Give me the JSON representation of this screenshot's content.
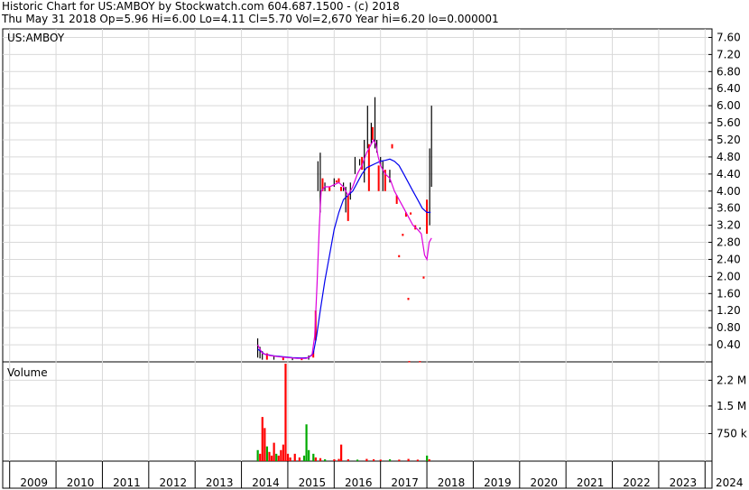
{
  "header": {
    "title": "Historic Chart for US:AMBOY by Stockwatch.com 604.687.1500 - (c) 2018",
    "info": "Thu May 31 2018  Op=5.96  Hi=6.00  Lo=4.11  Cl=5.70  Vol=2,670  Year hi=6.20  lo=0.000001"
  },
  "colors": {
    "up": "#000000",
    "down": "#ff0000",
    "ma_short": "#dd00dd",
    "ma_long": "#0000ee",
    "grid": "#d9d9d9",
    "vol_red": "#ff0000",
    "vol_green": "#00aa00"
  },
  "chart_data": [
    {
      "type": "line",
      "title": "US:AMBOY",
      "ylim": [
        0,
        7.8
      ],
      "y_ticks": [
        "7.60",
        "7.20",
        "6.80",
        "6.40",
        "6.00",
        "5.60",
        "5.20",
        "4.80",
        "4.40",
        "4.00",
        "3.60",
        "3.20",
        "2.80",
        "2.40",
        "2.00",
        "1.60",
        "1.20",
        "0.80",
        "0.40"
      ],
      "x_ticks": [
        "2009",
        "2010",
        "2011",
        "2012",
        "2013",
        "2014",
        "2015",
        "2016",
        "2017",
        "2018",
        "2019",
        "2020",
        "2021",
        "2022",
        "2023",
        "2024"
      ],
      "price_bars": [
        {
          "x": 2014.35,
          "hi": 0.55,
          "lo": 0.1,
          "c": "up"
        },
        {
          "x": 2014.4,
          "hi": 0.35,
          "lo": 0.08,
          "c": "up"
        },
        {
          "x": 2014.45,
          "hi": 0.25,
          "lo": 0.05,
          "c": "up"
        },
        {
          "x": 2014.55,
          "hi": 0.2,
          "lo": 0.05,
          "c": "down"
        },
        {
          "x": 2014.7,
          "hi": 0.15,
          "lo": 0.05,
          "c": "up"
        },
        {
          "x": 2014.9,
          "hi": 0.12,
          "lo": 0.04,
          "c": "down"
        },
        {
          "x": 2015.1,
          "hi": 0.1,
          "lo": 0.04,
          "c": "up"
        },
        {
          "x": 2015.3,
          "hi": 0.1,
          "lo": 0.04,
          "c": "down"
        },
        {
          "x": 2015.45,
          "hi": 0.15,
          "lo": 0.05,
          "c": "up"
        },
        {
          "x": 2015.55,
          "hi": 0.25,
          "lo": 0.1,
          "c": "down"
        },
        {
          "x": 2015.6,
          "hi": 1.2,
          "lo": 0.5,
          "c": "down"
        },
        {
          "x": 2015.65,
          "hi": 4.7,
          "lo": 4.0,
          "c": "up"
        },
        {
          "x": 2015.7,
          "hi": 4.9,
          "lo": 3.5,
          "c": "up"
        },
        {
          "x": 2015.75,
          "hi": 4.3,
          "lo": 4.0,
          "c": "down"
        },
        {
          "x": 2015.8,
          "hi": 4.2,
          "lo": 4.0,
          "c": "up"
        },
        {
          "x": 2015.9,
          "hi": 4.1,
          "lo": 4.0,
          "c": "down"
        },
        {
          "x": 2016.0,
          "hi": 4.3,
          "lo": 4.1,
          "c": "up"
        },
        {
          "x": 2016.05,
          "hi": 4.25,
          "lo": 4.2,
          "c": "down"
        },
        {
          "x": 2016.1,
          "hi": 4.3,
          "lo": 4.2,
          "c": "down"
        },
        {
          "x": 2016.15,
          "hi": 4.1,
          "lo": 4.0,
          "c": "down"
        },
        {
          "x": 2016.2,
          "hi": 4.2,
          "lo": 4.0,
          "c": "up"
        },
        {
          "x": 2016.25,
          "hi": 4.1,
          "lo": 3.5,
          "c": "up"
        },
        {
          "x": 2016.3,
          "hi": 3.9,
          "lo": 3.3,
          "c": "down"
        },
        {
          "x": 2016.35,
          "hi": 4.2,
          "lo": 3.8,
          "c": "up"
        },
        {
          "x": 2016.45,
          "hi": 4.8,
          "lo": 4.4,
          "c": "up"
        },
        {
          "x": 2016.55,
          "hi": 4.75,
          "lo": 4.6,
          "c": "up"
        },
        {
          "x": 2016.6,
          "hi": 4.8,
          "lo": 4.5,
          "c": "down"
        },
        {
          "x": 2016.65,
          "hi": 5.2,
          "lo": 4.2,
          "c": "up"
        },
        {
          "x": 2016.72,
          "hi": 6.0,
          "lo": 5.0,
          "c": "up"
        },
        {
          "x": 2016.75,
          "hi": 5.1,
          "lo": 4.0,
          "c": "down"
        },
        {
          "x": 2016.8,
          "hi": 5.6,
          "lo": 5.1,
          "c": "up"
        },
        {
          "x": 2016.83,
          "hi": 5.5,
          "lo": 5.2,
          "c": "down"
        },
        {
          "x": 2016.88,
          "hi": 6.2,
          "lo": 5.0,
          "c": "up"
        },
        {
          "x": 2016.92,
          "hi": 5.2,
          "lo": 4.9,
          "c": "up"
        },
        {
          "x": 2016.96,
          "hi": 4.6,
          "lo": 4.0,
          "c": "down"
        },
        {
          "x": 2017.0,
          "hi": 4.8,
          "lo": 4.6,
          "c": "up"
        },
        {
          "x": 2017.05,
          "hi": 4.7,
          "lo": 4.0,
          "c": "up"
        },
        {
          "x": 2017.1,
          "hi": 4.5,
          "lo": 4.0,
          "c": "down"
        },
        {
          "x": 2017.2,
          "hi": 4.5,
          "lo": 4.2,
          "c": "up"
        },
        {
          "x": 2017.25,
          "hi": 5.1,
          "lo": 5.0,
          "c": "down"
        },
        {
          "x": 2017.35,
          "hi": 3.9,
          "lo": 3.7,
          "c": "down"
        },
        {
          "x": 2017.4,
          "hi": 2.5,
          "lo": 2.45,
          "c": "down"
        },
        {
          "x": 2017.48,
          "hi": 3.0,
          "lo": 2.95,
          "c": "down"
        },
        {
          "x": 2017.55,
          "hi": 3.5,
          "lo": 3.4,
          "c": "down"
        },
        {
          "x": 2017.6,
          "hi": 1.5,
          "lo": 1.45,
          "c": "down"
        },
        {
          "x": 2017.65,
          "hi": 3.5,
          "lo": 3.45,
          "c": "down"
        },
        {
          "x": 2017.75,
          "hi": 3.2,
          "lo": 3.1,
          "c": "down"
        },
        {
          "x": 2017.85,
          "hi": 3.15,
          "lo": 3.1,
          "c": "up"
        },
        {
          "x": 2017.93,
          "hi": 2.0,
          "lo": 1.95,
          "c": "down"
        },
        {
          "x": 2018.0,
          "hi": 3.8,
          "lo": 3.0,
          "c": "down"
        },
        {
          "x": 2018.06,
          "hi": 5.0,
          "lo": 3.2,
          "c": "up"
        },
        {
          "x": 2018.1,
          "hi": 6.0,
          "lo": 4.1,
          "c": "up"
        },
        {
          "x": 2017.62,
          "hi": 0.02,
          "lo": 0.0,
          "c": "down"
        },
        {
          "x": 2017.85,
          "hi": 0.02,
          "lo": 0.0,
          "c": "down"
        }
      ],
      "ma_short": [
        [
          2014.35,
          0.4
        ],
        [
          2014.45,
          0.2
        ],
        [
          2014.6,
          0.15
        ],
        [
          2014.8,
          0.12
        ],
        [
          2015.0,
          0.1
        ],
        [
          2015.2,
          0.08
        ],
        [
          2015.4,
          0.08
        ],
        [
          2015.52,
          0.15
        ],
        [
          2015.58,
          0.6
        ],
        [
          2015.63,
          1.8
        ],
        [
          2015.68,
          3.2
        ],
        [
          2015.72,
          4.0
        ],
        [
          2015.8,
          4.1
        ],
        [
          2015.9,
          4.1
        ],
        [
          2016.0,
          4.15
        ],
        [
          2016.1,
          4.2
        ],
        [
          2016.2,
          4.1
        ],
        [
          2016.3,
          3.9
        ],
        [
          2016.4,
          4.1
        ],
        [
          2016.5,
          4.4
        ],
        [
          2016.6,
          4.6
        ],
        [
          2016.7,
          4.9
        ],
        [
          2016.8,
          5.1
        ],
        [
          2016.85,
          5.2
        ],
        [
          2016.9,
          5.1
        ],
        [
          2016.95,
          4.8
        ],
        [
          2017.0,
          4.6
        ],
        [
          2017.1,
          4.4
        ],
        [
          2017.2,
          4.3
        ],
        [
          2017.3,
          4.0
        ],
        [
          2017.4,
          3.8
        ],
        [
          2017.5,
          3.6
        ],
        [
          2017.6,
          3.4
        ],
        [
          2017.7,
          3.2
        ],
        [
          2017.8,
          3.1
        ],
        [
          2017.88,
          3.0
        ],
        [
          2017.95,
          2.5
        ],
        [
          2018.0,
          2.4
        ],
        [
          2018.05,
          2.8
        ],
        [
          2018.1,
          2.9
        ]
      ],
      "ma_long": [
        [
          2014.35,
          0.3
        ],
        [
          2014.5,
          0.18
        ],
        [
          2014.7,
          0.14
        ],
        [
          2014.9,
          0.12
        ],
        [
          2015.1,
          0.1
        ],
        [
          2015.3,
          0.09
        ],
        [
          2015.45,
          0.1
        ],
        [
          2015.55,
          0.2
        ],
        [
          2015.62,
          0.6
        ],
        [
          2015.7,
          1.2
        ],
        [
          2015.8,
          1.9
        ],
        [
          2015.9,
          2.5
        ],
        [
          2016.0,
          3.1
        ],
        [
          2016.1,
          3.5
        ],
        [
          2016.2,
          3.8
        ],
        [
          2016.3,
          3.9
        ],
        [
          2016.4,
          4.0
        ],
        [
          2016.5,
          4.2
        ],
        [
          2016.6,
          4.4
        ],
        [
          2016.7,
          4.55
        ],
        [
          2016.8,
          4.6
        ],
        [
          2016.9,
          4.65
        ],
        [
          2017.0,
          4.7
        ],
        [
          2017.1,
          4.72
        ],
        [
          2017.2,
          4.75
        ],
        [
          2017.3,
          4.7
        ],
        [
          2017.4,
          4.6
        ],
        [
          2017.5,
          4.4
        ],
        [
          2017.6,
          4.2
        ],
        [
          2017.7,
          4.0
        ],
        [
          2017.8,
          3.8
        ],
        [
          2017.9,
          3.6
        ],
        [
          2018.0,
          3.5
        ],
        [
          2018.08,
          3.5
        ]
      ]
    },
    {
      "type": "bar",
      "title": "Volume",
      "ylim": [
        0,
        2700000
      ],
      "y_ticks": [
        {
          "label": "2.2 M",
          "v": 2200000
        },
        {
          "label": "1.5 M",
          "v": 1500000
        },
        {
          "label": "750 k",
          "v": 750000
        }
      ],
      "bars": [
        {
          "x": 2014.35,
          "v": 300000,
          "c": "green"
        },
        {
          "x": 2014.4,
          "v": 200000,
          "c": "red"
        },
        {
          "x": 2014.45,
          "v": 1200000,
          "c": "red"
        },
        {
          "x": 2014.5,
          "v": 900000,
          "c": "red"
        },
        {
          "x": 2014.55,
          "v": 400000,
          "c": "green"
        },
        {
          "x": 2014.6,
          "v": 250000,
          "c": "red"
        },
        {
          "x": 2014.65,
          "v": 150000,
          "c": "red"
        },
        {
          "x": 2014.7,
          "v": 500000,
          "c": "red"
        },
        {
          "x": 2014.75,
          "v": 200000,
          "c": "green"
        },
        {
          "x": 2014.8,
          "v": 150000,
          "c": "red"
        },
        {
          "x": 2014.85,
          "v": 300000,
          "c": "red"
        },
        {
          "x": 2014.9,
          "v": 450000,
          "c": "red"
        },
        {
          "x": 2014.95,
          "v": 2900000,
          "c": "red"
        },
        {
          "x": 2015.0,
          "v": 200000,
          "c": "red"
        },
        {
          "x": 2015.05,
          "v": 100000,
          "c": "red"
        },
        {
          "x": 2015.15,
          "v": 200000,
          "c": "red"
        },
        {
          "x": 2015.25,
          "v": 100000,
          "c": "red"
        },
        {
          "x": 2015.35,
          "v": 150000,
          "c": "green"
        },
        {
          "x": 2015.4,
          "v": 1000000,
          "c": "green"
        },
        {
          "x": 2015.45,
          "v": 300000,
          "c": "green"
        },
        {
          "x": 2015.55,
          "v": 200000,
          "c": "green"
        },
        {
          "x": 2015.6,
          "v": 100000,
          "c": "red"
        },
        {
          "x": 2015.7,
          "v": 80000,
          "c": "red"
        },
        {
          "x": 2015.8,
          "v": 50000,
          "c": "green"
        },
        {
          "x": 2016.0,
          "v": 50000,
          "c": "red"
        },
        {
          "x": 2016.1,
          "v": 60000,
          "c": "red"
        },
        {
          "x": 2016.15,
          "v": 450000,
          "c": "red"
        },
        {
          "x": 2016.3,
          "v": 50000,
          "c": "red"
        },
        {
          "x": 2016.5,
          "v": 40000,
          "c": "green"
        },
        {
          "x": 2016.7,
          "v": 60000,
          "c": "red"
        },
        {
          "x": 2016.85,
          "v": 50000,
          "c": "red"
        },
        {
          "x": 2017.0,
          "v": 40000,
          "c": "red"
        },
        {
          "x": 2017.2,
          "v": 50000,
          "c": "green"
        },
        {
          "x": 2017.4,
          "v": 40000,
          "c": "red"
        },
        {
          "x": 2017.6,
          "v": 60000,
          "c": "red"
        },
        {
          "x": 2017.8,
          "v": 40000,
          "c": "red"
        },
        {
          "x": 2018.0,
          "v": 150000,
          "c": "green"
        },
        {
          "x": 2018.05,
          "v": 50000,
          "c": "red"
        }
      ]
    }
  ]
}
